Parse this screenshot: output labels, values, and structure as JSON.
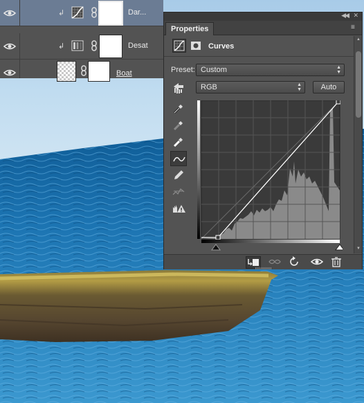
{
  "layers_panel": {
    "layers": [
      {
        "name": "Dar...",
        "type": "curves-adjustment",
        "selected": true,
        "visible": true,
        "clipped": true
      },
      {
        "name": "Desat",
        "type": "hue-saturation-adjustment",
        "selected": false,
        "visible": true,
        "clipped": true
      },
      {
        "name": "Boat",
        "type": "pixel-layer",
        "selected": false,
        "visible": true,
        "clipped": false
      }
    ]
  },
  "properties_panel": {
    "tab_label": "Properties",
    "adjustment_title": "Curves",
    "preset_label": "Preset:",
    "preset_value": "Custom",
    "channel_value": "RGB",
    "auto_button": "Auto",
    "tools": [
      "on-image-adjust-icon",
      "sample-black-point-icon",
      "sample-gray-point-icon",
      "sample-white-point-icon",
      "edit-points-curve-icon",
      "draw-curve-icon",
      "smooth-curve-icon",
      "clipping-warning-icon"
    ],
    "footer_buttons": [
      "clip-to-layer-icon",
      "view-previous-state-icon",
      "reset-icon",
      "visibility-icon",
      "delete-icon"
    ]
  },
  "curve": {
    "points": [
      [
        16,
        0
      ],
      [
        255,
        255
      ]
    ],
    "histogram_description": "luminosity histogram shown behind curve grid"
  },
  "colors": {
    "panel_bg": "#535353",
    "selected_layer": "#6b7c94",
    "sea": "#1f74b0"
  }
}
